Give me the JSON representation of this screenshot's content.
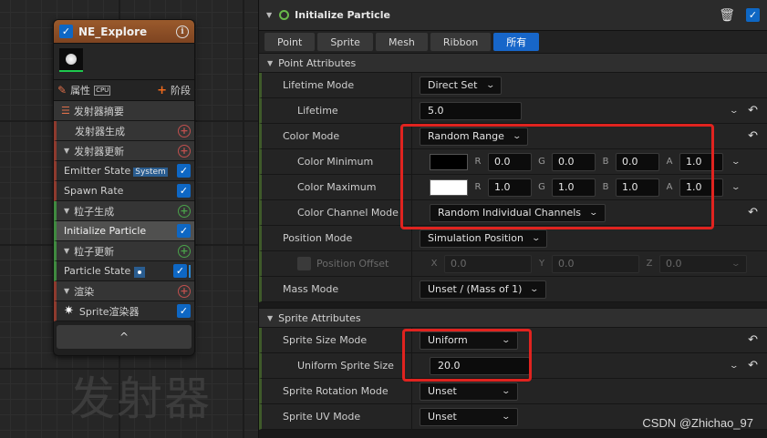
{
  "graph": {
    "watermark_text": "发射器",
    "node": {
      "title": "NE_Explore",
      "properties_label": "属性",
      "cpu_label": "CPU",
      "stage_label": "阶段",
      "summary_label": "发射器摘要",
      "rows": [
        {
          "label": "发射器生成",
          "kind": "section-red",
          "style": "indent"
        },
        {
          "label": "发射器更新",
          "kind": "section-red",
          "style": "collapsible"
        },
        {
          "label": "Emitter State",
          "kind": "module",
          "badge": "System"
        },
        {
          "label": "Spawn Rate",
          "kind": "module"
        },
        {
          "label": "粒子生成",
          "kind": "section-green",
          "style": "collapsible"
        },
        {
          "label": "Initialize Particle",
          "kind": "module-selected"
        },
        {
          "label": "粒子更新",
          "kind": "section-green",
          "style": "collapsible"
        },
        {
          "label": "Particle State",
          "kind": "module-dot"
        },
        {
          "label": "渲染",
          "kind": "section-red",
          "style": "collapsible"
        },
        {
          "label": "Sprite渲染器",
          "kind": "renderer"
        }
      ],
      "collapse_glyph": "^"
    }
  },
  "details": {
    "title": "Initialize Particle",
    "tabs": [
      {
        "label": "Point",
        "active": false
      },
      {
        "label": "Sprite",
        "active": false
      },
      {
        "label": "Mesh",
        "active": false
      },
      {
        "label": "Ribbon",
        "active": false
      },
      {
        "label": "所有",
        "active": true
      }
    ],
    "point_attributes": {
      "header": "Point Attributes",
      "lifetime_mode": {
        "label": "Lifetime Mode",
        "value": "Direct Set"
      },
      "lifetime": {
        "label": "Lifetime",
        "value": "5.0"
      },
      "color_mode": {
        "label": "Color Mode",
        "value": "Random Range"
      },
      "color_minimum": {
        "label": "Color Minimum",
        "swatch": "#000000",
        "r_label": "R",
        "r": "0.0",
        "g_label": "G",
        "g": "0.0",
        "b_label": "B",
        "b": "0.0",
        "a_label": "A",
        "a": "1.0"
      },
      "color_maximum": {
        "label": "Color Maximum",
        "swatch": "#ffffff",
        "r_label": "R",
        "r": "1.0",
        "g_label": "G",
        "g": "1.0",
        "b_label": "B",
        "b": "1.0",
        "a_label": "A",
        "a": "1.0"
      },
      "color_channel_mode": {
        "label": "Color Channel Mode",
        "value": "Random Individual Channels"
      },
      "position_mode": {
        "label": "Position Mode",
        "value": "Simulation Position"
      },
      "position_offset": {
        "label": "Position Offset",
        "x_label": "X",
        "x": "0.0",
        "y_label": "Y",
        "y": "0.0",
        "z_label": "Z",
        "z": "0.0"
      },
      "mass_mode": {
        "label": "Mass Mode",
        "value": "Unset / (Mass of 1)"
      }
    },
    "sprite_attributes": {
      "header": "Sprite Attributes",
      "size_mode": {
        "label": "Sprite Size Mode",
        "value": "Uniform"
      },
      "uniform_size": {
        "label": "Uniform Sprite Size",
        "value": "20.0"
      },
      "rotation_mode": {
        "label": "Sprite Rotation Mode",
        "value": "Unset"
      },
      "uv_mode": {
        "label": "Sprite UV Mode",
        "value": "Unset"
      }
    }
  },
  "watermark": "CSDN @Zhichao_97",
  "colors": {
    "accent_blue": "#1766c9",
    "highlight_red": "#e0231f",
    "node_header": "#9a5a2c",
    "active_green": "#69b84a"
  },
  "icons": [
    "pencil-icon",
    "info-icon",
    "trash-icon",
    "reset-icon",
    "chevron-down-icon",
    "ring-icon",
    "sprite-icon",
    "list-icon"
  ]
}
